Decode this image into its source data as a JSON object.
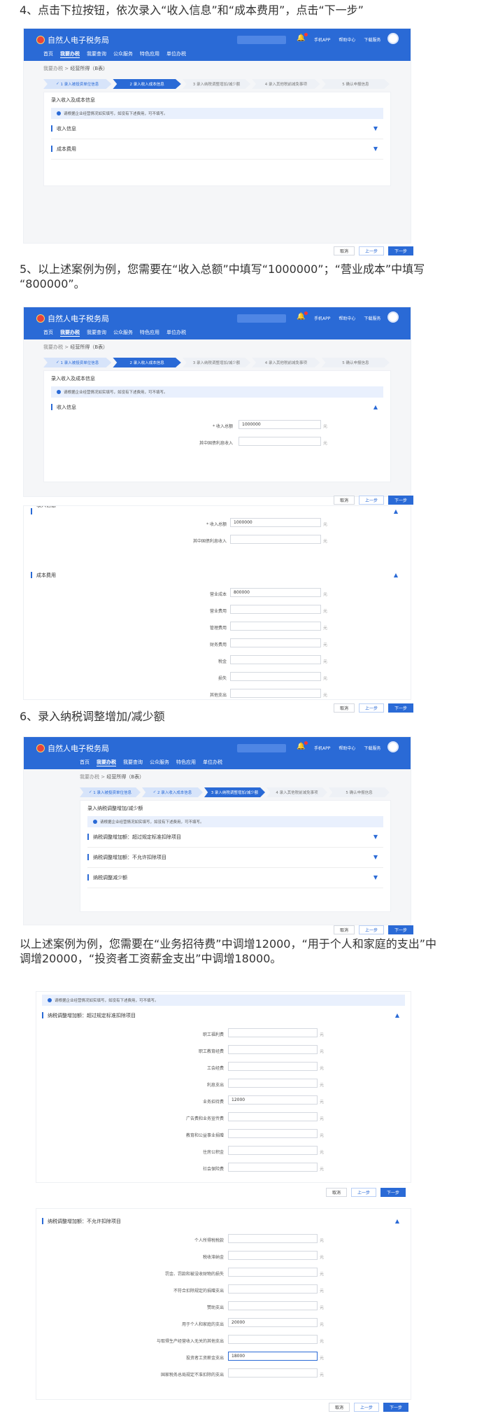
{
  "headings": {
    "step4": "4、点击下拉按钮，依次录入“收入信息”和“成本费用”，点击“下一步”",
    "step5_line1": "5、以上述案例为例，您需要在“收入总额”中填写“1000000”；“营业成本”中填写",
    "step5_line2": "“800000”。",
    "step6": "6、录入纳税调整增加/减少额",
    "step6b_line1": "以上述案例为例，您需要在“业务招待费”中调增12000，“用于个人和家庭的支出”中",
    "step6b_line2": "调增20000，“投资者工资薪金支出”中调增18000。"
  },
  "app": {
    "title": "自然人电子税务局",
    "nav": [
      "首页",
      "我要办税",
      "我要查询",
      "公众服务",
      "特色应用",
      "单位办税"
    ],
    "links": [
      "手机APP",
      "帮助中心",
      "下载服务"
    ],
    "breadcrumb": [
      "我要办税",
      "经营所得（B表）"
    ]
  },
  "steps": [
    "1 录入被投资单位信息",
    "2 录入收入成本信息",
    "3 录入纳税调整增加/减少额",
    "4 录入其他税前减免事项",
    "5 确认申报信息"
  ],
  "step_done": "✓",
  "card_titles": {
    "income_cost": "录入收入及成本信息",
    "tax_adjust": "录入纳税调整增加/减少额"
  },
  "notice": "请根据企业经营情况如实填写，如没有下述费用，可不填写。",
  "sections": {
    "income": "收入信息",
    "cost": "成本费用",
    "adj_increase": "纳税调整增加额：超过规定标准扣除项目",
    "adj_increase_b": "纳税调整增加额：不允许扣除项目",
    "adj_decrease": "纳税调整减少额"
  },
  "income_fields": [
    {
      "label": "* 收入总额",
      "value": "1000000"
    },
    {
      "label": "其中国债利息收入",
      "value": ""
    }
  ],
  "cost_fields": [
    {
      "label": "营业成本",
      "value": "800000"
    },
    {
      "label": "营业费用",
      "value": ""
    },
    {
      "label": "管理费用",
      "value": ""
    },
    {
      "label": "财务费用",
      "value": ""
    },
    {
      "label": "税金",
      "value": ""
    },
    {
      "label": "损失",
      "value": ""
    },
    {
      "label": "其他支出",
      "value": ""
    }
  ],
  "adj1_fields": [
    {
      "label": "职工福利费",
      "value": ""
    },
    {
      "label": "职工教育经费",
      "value": ""
    },
    {
      "label": "工会经费",
      "value": ""
    },
    {
      "label": "利息支出",
      "value": ""
    },
    {
      "label": "业务招待费",
      "value": "12000"
    },
    {
      "label": "广告费和业务宣传费",
      "value": ""
    },
    {
      "label": "教育和公益事业捐赠",
      "value": ""
    },
    {
      "label": "住房公积金",
      "value": ""
    },
    {
      "label": "社会保险费",
      "value": ""
    }
  ],
  "adj2_fields": [
    {
      "label": "个人所得税税款",
      "value": ""
    },
    {
      "label": "税收滞纳金",
      "value": ""
    },
    {
      "label": "罚金、罚款和被没收财物的损失",
      "value": ""
    },
    {
      "label": "不符合扣除规定的捐赠支出",
      "value": ""
    },
    {
      "label": "赞助支出",
      "value": ""
    },
    {
      "label": "用于个人和家庭的支出",
      "value": "20000"
    },
    {
      "label": "与取得生产经营收入无关的其他支出",
      "value": ""
    },
    {
      "label": "投资者工资薪金支出",
      "value": "18000"
    },
    {
      "label": "国家税务总局规定不准扣除的支出",
      "value": ""
    }
  ],
  "unit": "元",
  "buttons": {
    "cancel": "取消",
    "prev": "上一步",
    "next": "下一步"
  },
  "colors": {
    "brand": "#2a6ad6",
    "notice_bg": "#e9f0fd"
  }
}
